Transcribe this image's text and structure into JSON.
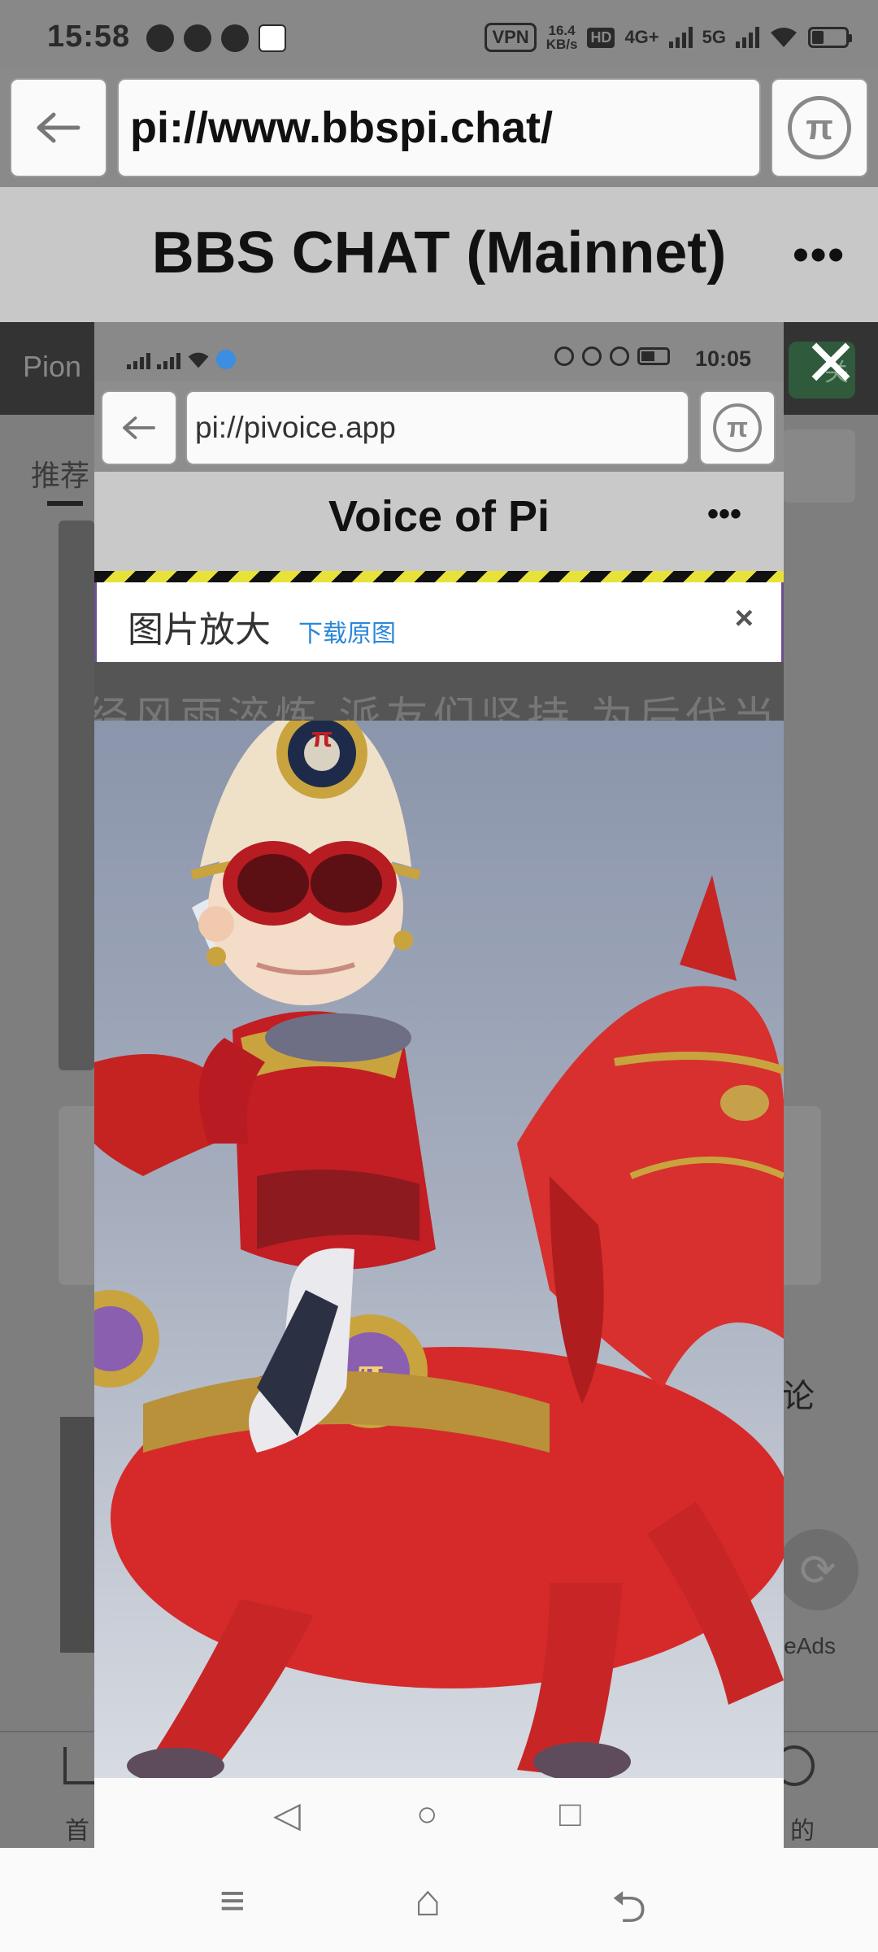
{
  "status_bar": {
    "time": "15:58",
    "vpn": "VPN",
    "net_speed_top": "16.4",
    "net_speed_bottom": "KB/s",
    "hd": "HD",
    "net1": "4G+",
    "net2": "5G"
  },
  "browser": {
    "url": "pi://www.bbspi.chat/",
    "back_icon": "arrow-left-icon",
    "pi_icon": "pi-logo-icon"
  },
  "header": {
    "title": "BBS CHAT (Mainnet)",
    "more": "•••"
  },
  "background_app": {
    "name_partial": "Pion",
    "follow_partial": "关",
    "tab_partial": "推荐",
    "comment_partial": "论",
    "ads_partial": "eAds",
    "nav_home_partial": "首",
    "nav_mine_partial": "的"
  },
  "overlay": {
    "close_icon": "close-icon",
    "close_glyph": "✕"
  },
  "inner": {
    "status_time": "10:05",
    "url": "pi://pivoice.app",
    "title": "Voice of Pi",
    "more": "•••",
    "dialog_title": "图片放大",
    "download_link": "下载原图",
    "dialog_close": "×",
    "truncated_text": "经风雨淬炼 派友们坚持 为后代当"
  },
  "inner_nav": {
    "back": "◁",
    "home": "○",
    "recents": "□"
  },
  "outer_nav": {
    "menu": "≡",
    "home": "⌂",
    "back": "⮌"
  }
}
